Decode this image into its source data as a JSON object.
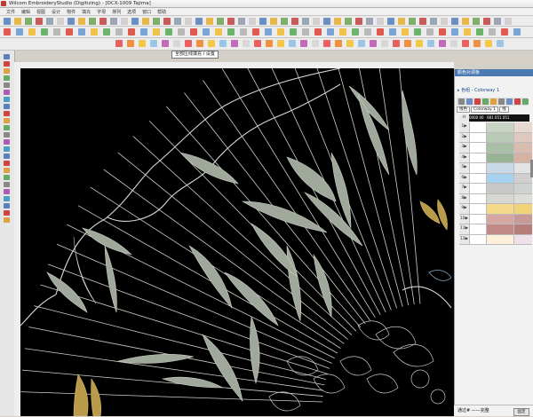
{
  "window": {
    "title": "Wilcom EmbroideryStudio (Digitizing) - [DCX-1009     Tajima]"
  },
  "menu": {
    "items": [
      "文件",
      "编辑",
      "视图",
      "设计",
      "物件",
      "填充",
      "字母",
      "排列",
      "选项",
      "窗口",
      "帮助"
    ]
  },
  "toolbar": {
    "zoom_value": "100"
  },
  "tooltip": {
    "text": "全部压线填充 / 设置"
  },
  "panel": {
    "title": "颜色对调板",
    "colorway": "▸ 色组 - Colorway 1",
    "tabs": [
      "线色",
      "Colorway 1",
      "线"
    ],
    "header_cells": [
      "0000 00",
      "081 051 051"
    ],
    "rows": [
      {
        "num": "1▶",
        "c1": "#c9d3c6",
        "c2": "#e8d8d2"
      },
      {
        "num": "2▶",
        "c1": "#b9cab6",
        "c2": "#e0c8bf"
      },
      {
        "num": "3▶",
        "c1": "#a8bea5",
        "c2": "#d9bcb0"
      },
      {
        "num": "4▶",
        "c1": "#97b294",
        "c2": "#d6b2a3"
      },
      {
        "num": "5▶",
        "c1": "#c9dae7",
        "c2": "#e4e4e4"
      },
      {
        "num": "6▶",
        "c1": "#a6d1ef",
        "c2": "#cfcfcf"
      },
      {
        "num": "7▶",
        "c1": "#c8c8c8",
        "c2": "#cfd3cf"
      },
      {
        "num": "8▶",
        "c1": "#d6d6d2",
        "c2": "#dcdcd8"
      },
      {
        "num": "9▶",
        "c1": "#f5d98a",
        "c2": "#f2d37a"
      },
      {
        "num": "10▶",
        "c1": "#d5a7a3",
        "c2": "#c89a97"
      },
      {
        "num": "11▶",
        "c1": "#c28a86",
        "c2": "#b67d79"
      },
      {
        "num": "12▶",
        "c1": "#fff0db",
        "c2": "#efe0ea"
      }
    ],
    "status_text": "通过# ——完整",
    "status_button": "固定"
  },
  "colors": {
    "accent": "#4a7ab0",
    "canvas": "#000000",
    "thread_white": "#d8d8d2",
    "thread_gold": "#c9a94a"
  }
}
